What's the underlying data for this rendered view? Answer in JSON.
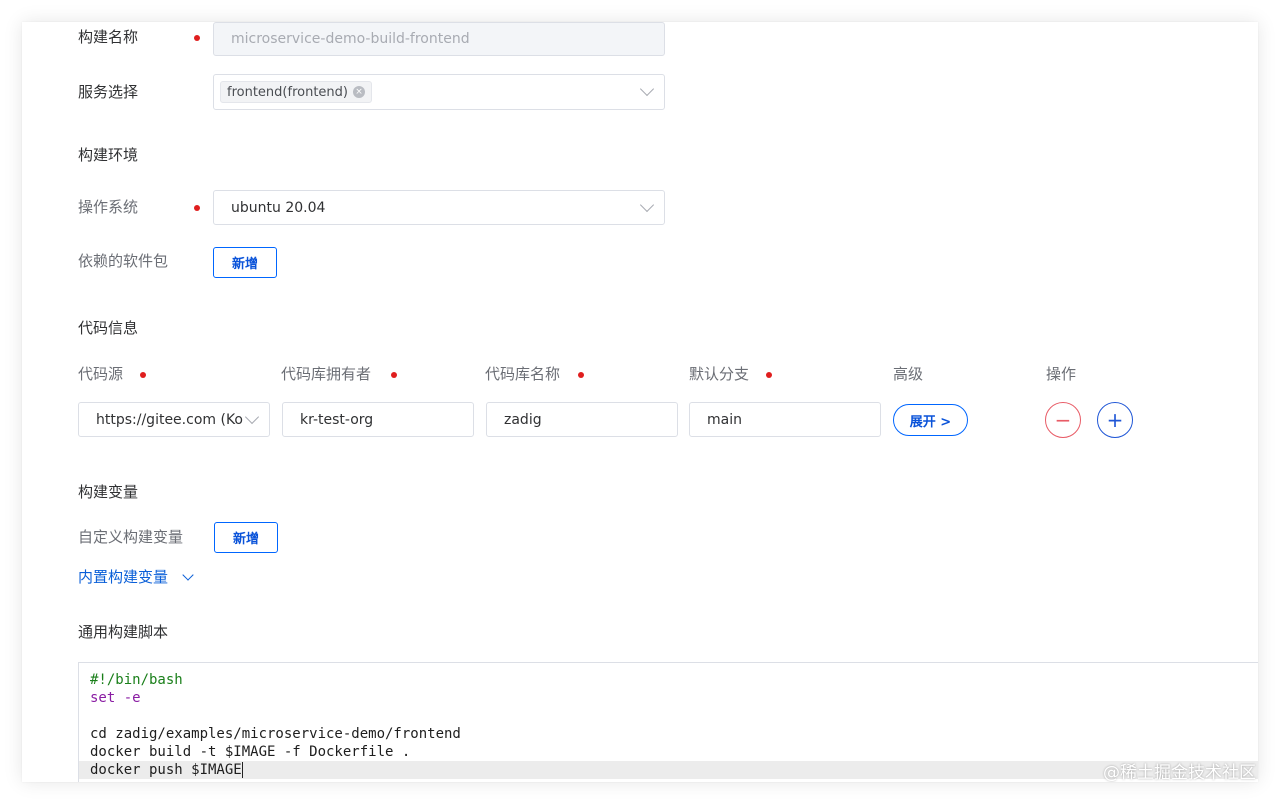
{
  "form": {
    "build_name": {
      "label": "构建名称",
      "value": "microservice-demo-build-frontend"
    },
    "service_select": {
      "label": "服务选择",
      "tag": "frontend(frontend)",
      "tag_close": "×"
    }
  },
  "build_env": {
    "title": "构建环境",
    "os": {
      "label": "操作系统",
      "value": "ubuntu 20.04"
    },
    "packages": {
      "label": "依赖的软件包",
      "add_label": "新增"
    }
  },
  "code_info": {
    "title": "代码信息",
    "columns": [
      "代码源",
      "代码库拥有者",
      "代码库名称",
      "默认分支",
      "高级",
      "操作"
    ],
    "row": {
      "source": "https://gitee.com (Ko",
      "owner": "kr-test-org",
      "repo": "zadig",
      "branch": "main",
      "advanced_label": "展开 >",
      "remove_symbol": "−",
      "add_symbol": "+"
    }
  },
  "build_vars": {
    "title": "构建变量",
    "custom": {
      "label": "自定义构建变量",
      "add_label": "新增"
    },
    "builtin_toggle": "内置构建变量"
  },
  "script": {
    "title": "通用构建脚本",
    "lines": [
      "#!/bin/bash",
      "set -e",
      "",
      "cd zadig/examples/microservice-demo/frontend",
      "docker build -t $IMAGE -f Dockerfile .",
      "docker push $IMAGE"
    ]
  },
  "watermark": "@稀土掘金技术社区",
  "colors": {
    "primary": "#0066ff",
    "required": "#e01e1e",
    "danger": "#e85b66"
  }
}
